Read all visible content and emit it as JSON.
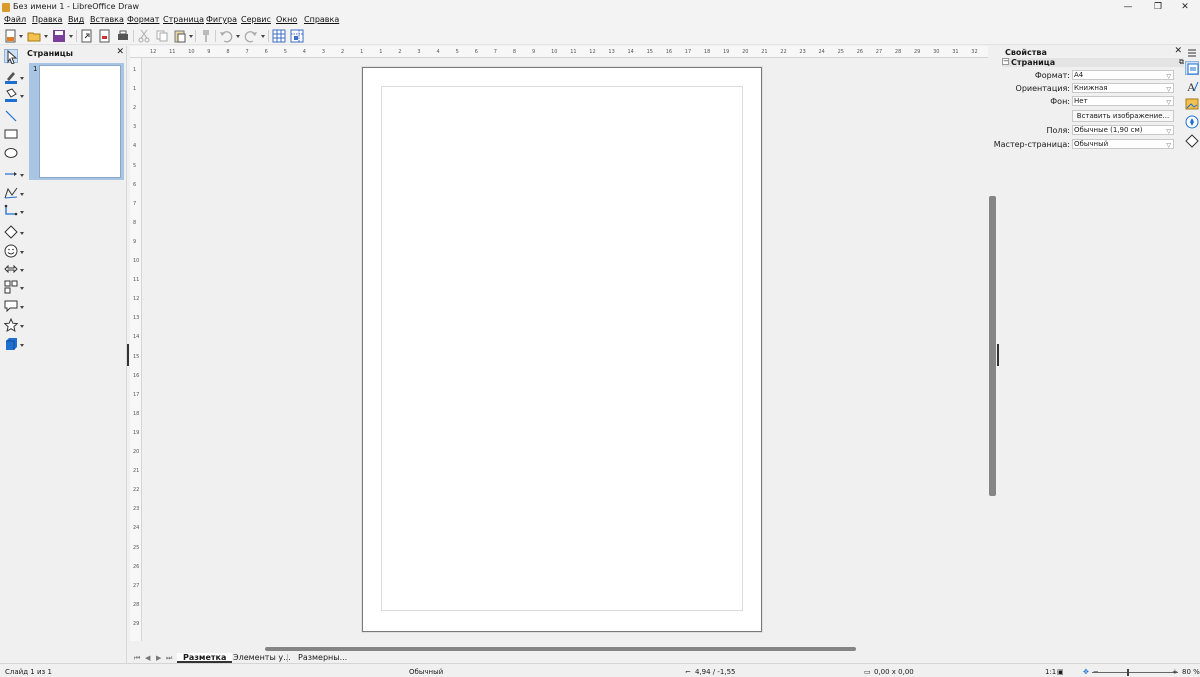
{
  "window": {
    "title": "Без имени 1 - LibreOffice Draw"
  },
  "menu": {
    "items": [
      "Файл",
      "Правка",
      "Вид",
      "Вставка",
      "Формат",
      "Страница",
      "Фигура",
      "Сервис",
      "Окно",
      "Справка"
    ]
  },
  "pages_panel": {
    "title": "Страницы",
    "page_number": "1"
  },
  "ruler": {
    "h_labels": [
      "12",
      "11",
      "10",
      "9",
      "8",
      "7",
      "6",
      "5",
      "4",
      "3",
      "2",
      "1",
      "1",
      "2",
      "3",
      "4",
      "5",
      "6",
      "7",
      "8",
      "9",
      "10",
      "11",
      "12",
      "13",
      "14",
      "15",
      "16",
      "17",
      "18",
      "19",
      "20",
      "21",
      "22",
      "23",
      "24",
      "25",
      "26",
      "27",
      "28",
      "29",
      "30",
      "31",
      "32"
    ],
    "v_labels": [
      "1",
      "1",
      "2",
      "3",
      "4",
      "5",
      "6",
      "7",
      "8",
      "9",
      "10",
      "11",
      "12",
      "13",
      "14",
      "15",
      "16",
      "17",
      "18",
      "19",
      "20",
      "21",
      "22",
      "23",
      "24",
      "25",
      "26",
      "27",
      "28",
      "29"
    ]
  },
  "tabs": {
    "items": [
      "Разметка",
      "Элементы у...",
      "Размерны..."
    ]
  },
  "sidebar": {
    "title": "Свойства",
    "section": "Страница",
    "format_label": "Формат:",
    "format_value": "A4",
    "orientation_label": "Ориентация:",
    "orientation_value": "Книжная",
    "background_label": "Фон:",
    "background_value": "Нет",
    "insert_image_label": "Вставить изображение...",
    "margins_label": "Поля:",
    "margins_value": "Обычные (1,90 см)",
    "master_label": "Мастер-страница:",
    "master_value": "Обычный"
  },
  "status": {
    "slide": "Слайд 1 из 1",
    "master": "Обычный",
    "position": "4,94 / -1,55",
    "size": "0,00 x 0,00",
    "scale": "1:1",
    "zoom": "80 %"
  },
  "colors": {
    "accent_blue": "#1e6fd0",
    "highlight": "#a8c5e4",
    "brand_orange": "#d89b2c"
  }
}
